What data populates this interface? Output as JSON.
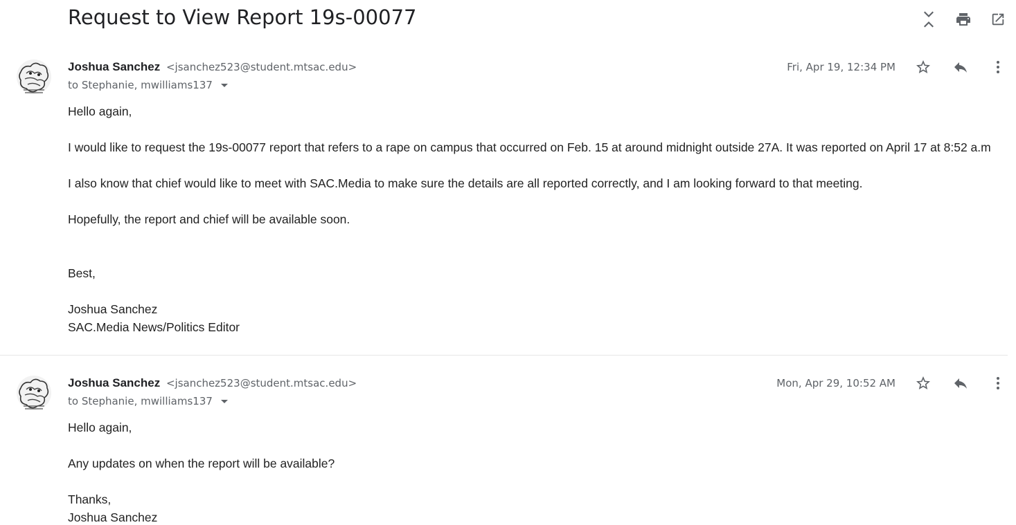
{
  "thread": {
    "title": "Request to View Report 19s-00077",
    "icons": [
      "expand-collapse-icon",
      "print-icon",
      "open-in-new-window-icon"
    ]
  },
  "messages": [
    {
      "sender_name": "Joshua Sanchez",
      "sender_email": "<jsanchez523@student.mtsac.edu>",
      "to": "to Stephanie, mwilliams137",
      "date": "Fri, Apr 19, 12:34 PM",
      "body": [
        "Hello again,",
        "I would like to request the 19s-00077 report that refers to a rape on campus that occurred on Feb. 15 at around midnight outside 27A. It was reported on April 17 at 8:52 a.m",
        "I also know that chief would like to meet with SAC.Media to make sure the details are all reported correctly, and I am looking forward to that meeting.",
        "Hopefully, the report and chief will be available soon.",
        "Best,",
        "Joshua Sanchez",
        "SAC.Media News/Politics Editor"
      ]
    },
    {
      "sender_name": "Joshua Sanchez",
      "sender_email": "<jsanchez523@student.mtsac.edu>",
      "to": "to Stephanie, mwilliams137",
      "date": "Mon, Apr 29, 10:52 AM",
      "body": [
        "Hello again,",
        "Any updates on when the report will be available?",
        "Thanks,",
        "Joshua Sanchez"
      ]
    }
  ],
  "colors": {
    "text": "#222222",
    "secondary": "#5f6368",
    "divider": "#e6e6e6"
  }
}
